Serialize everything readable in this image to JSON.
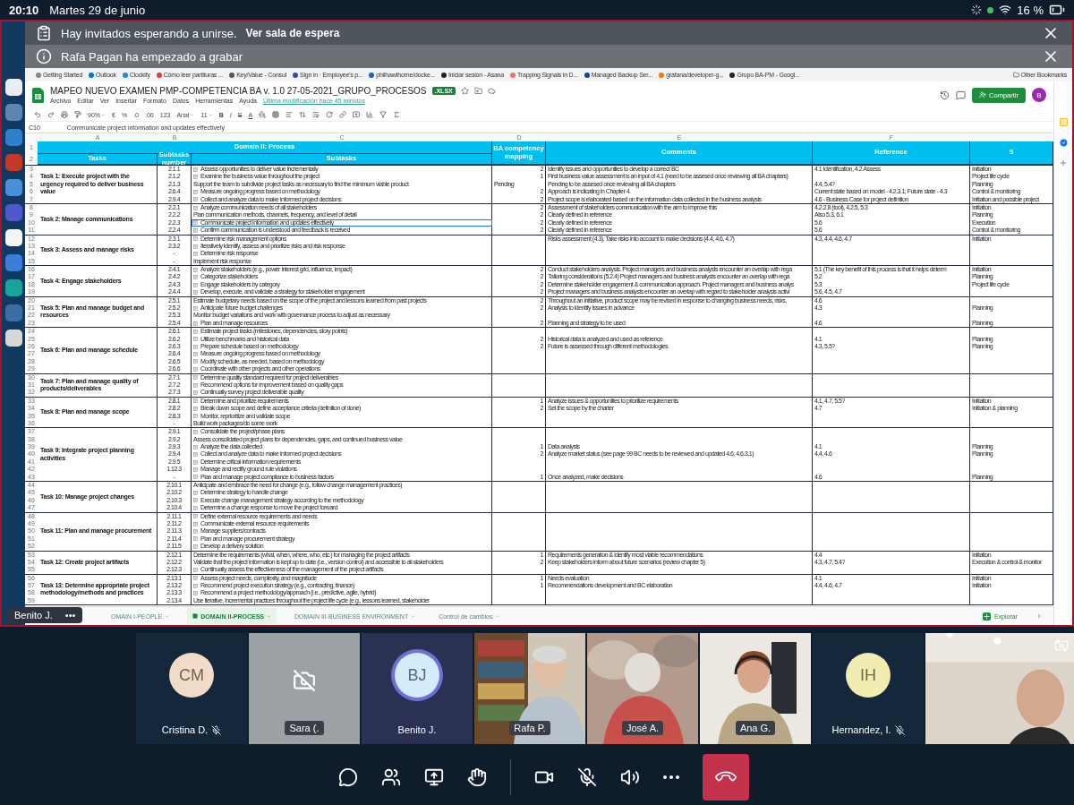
{
  "status_bar": {
    "time": "20:10",
    "date": "Martes 29 de junio",
    "battery": "16 %"
  },
  "banners": [
    {
      "kind": "lobby",
      "text": "Hay invitados esperando a unirse.",
      "link": "Ver sala de espera"
    },
    {
      "kind": "info",
      "text": "Rafa Pagan ha empezado a grabar"
    }
  ],
  "bookmarks": [
    "Getting Started",
    "Outlook",
    "Clockify",
    "Cómo leer partituras ...",
    "Key/Value - Consul",
    "Sign in · Employee's p...",
    "philhawthorne/docke...",
    "Iniciar sesión - Asana",
    "Trapping Signals in D...",
    "Managed Backup Ser...",
    "grafana/developer-g...",
    "Grupo BA-PM - Googl..."
  ],
  "other_bookmarks": "Other Bookmarks",
  "sheet": {
    "title": "MAPEO NUEVO EXAMEN PMP-COMPETENCIA BA v. 1.0 27-05-2021_GRUPO_PROCESOS",
    "badge": ".XLSX",
    "menus": [
      "Archivo",
      "Editar",
      "Ver",
      "Insertar",
      "Formato",
      "Datos",
      "Herramientas",
      "Ayuda"
    ],
    "last_edit": "Última modificación hace 45 minutos",
    "share": "Compartir",
    "avatar": "B",
    "toolbar": [
      {
        "kind": "zoom",
        "text": "90%"
      },
      {
        "kind": "format",
        "text": "€"
      },
      {
        "kind": "format",
        "text": "%"
      },
      {
        "kind": "format",
        "text": ".0"
      },
      {
        "kind": "format",
        "text": ".00"
      },
      {
        "kind": "format",
        "text": "123"
      },
      {
        "kind": "font",
        "text": "Arial"
      },
      {
        "kind": "size",
        "text": "11"
      },
      {
        "kind": "bold",
        "text": "B"
      },
      {
        "kind": "italic",
        "text": "I"
      },
      {
        "kind": "strike",
        "text": "S"
      },
      {
        "kind": "color",
        "text": "A"
      }
    ],
    "formula_bar": {
      "cell": "C10",
      "value": "Communicate project information and updates effectively"
    },
    "column_letters": [
      "A",
      "B",
      "C",
      "D",
      "E",
      "F"
    ],
    "header_rows": [
      "1",
      "2"
    ],
    "domain_title": "Domain II: Process",
    "columns": [
      "Tasks",
      "Subtasks number",
      "Subtasks",
      "BA competency mapping",
      "Comments",
      "Reference",
      "S"
    ],
    "tasks": [
      {
        "title": "Task 1: Execute project with the urgency required to deliver business value",
        "subtasks": [
          {
            "row": "3",
            "number": "2.1.1",
            "text": "Assess opportunities to deliver value incrementally",
            "icon": true,
            "selected": false,
            "score": "2",
            "comment": "Identify issues and opportunities to develop a correct BC",
            "reference": "4.1 Identification, 4.2 Assess",
            "stage": "Initiation"
          },
          {
            "row": "4",
            "number": "2.1.2",
            "text": "Examine the business value throughout the project",
            "icon": true,
            "selected": false,
            "score": "1",
            "comment": "First business value assessment is an input of 4.1 (need to be assesed once reviewing all BA chapters)",
            "stage": "Project life cycle"
          },
          {
            "row": "5",
            "number": "2.1.3",
            "text": "Support the team to subdivide project tasks as necessary to find the minimum viable product",
            "icon": false,
            "selected": false,
            "mapping": "Pending",
            "comment": "Pending to be assesed once reviewing all BA chapters",
            "reference": "4.4, 5.4?",
            "stage": "Planning"
          },
          {
            "row": "6",
            "number": "2.6.4",
            "text": "Measure ongoing progress based on methodology",
            "icon": true,
            "selected": false,
            "score": "2",
            "comment": "Approach is indicating in Chapter 4.",
            "reference": "Current state based on model - 4.2.3.1; Future state - 4.3",
            "stage": "Control & monitoring"
          },
          {
            "row": "7",
            "number": "2.9.4",
            "text": "Collect and analyze data to make informed project decisions",
            "icon": true,
            "selected": false,
            "score": "2",
            "comment": "Project scope is elaborated based on the information data collected  in the business analysis",
            "reference": "4.6 - Business Case for project definition",
            "stage": "Initiation and possible project"
          }
        ]
      },
      {
        "title": "Task 2: Manage communications",
        "subtasks": [
          {
            "row": "8",
            "number": "2.2.1",
            "text": "Analyze communication needs of all stakeholders",
            "icon": true,
            "selected": false,
            "score": "2",
            "comment": "Assessment of stakeholders communication with the aim to improve this",
            "reference": "4.2.2.8 (tool), 4.2.5, 5.3",
            "stage": "Initiation"
          },
          {
            "row": "9",
            "number": "2.2.2",
            "text": "Plan communication methods, channels, frequency, and level of detail",
            "icon": false,
            "selected": false,
            "score": "2",
            "comment": "Clearly defined in reference",
            "reference": "Also 5.3, 6.1",
            "stage": "Planning"
          },
          {
            "row": "10",
            "number": "2.2.3",
            "text": "Communicate project information and updates effectively",
            "icon": true,
            "selected": true,
            "score": "2",
            "comment": "Clearly defined in reference",
            "reference": "5.6",
            "stage": "Execution"
          },
          {
            "row": "11",
            "number": "2.2.4",
            "text": "Confirm communication is understood and feedback is received",
            "icon": true,
            "selected": false,
            "score": "2",
            "comment": "Clearly defined in reference",
            "reference": "5.6",
            "stage": "Control & monitoring"
          }
        ]
      },
      {
        "title": "Task 3: Assess and manage risks",
        "subtasks": [
          {
            "row": "12",
            "number": "2.3.1",
            "text": "Determine risk management options",
            "icon": true,
            "selected": false,
            "comment": "Risks assessment (4.3). Take risks into account to make decisions  (4.4, 4.6, 4.7)",
            "reference": "4.3, 4.4, 4.6, 4.7",
            "stage": "Initiation"
          },
          {
            "row": "13",
            "number": "2.3.2",
            "text": "Iteratively identify, assess and prioritize risks and risk response",
            "icon": true,
            "selected": false
          },
          {
            "row": "14",
            "number": "-",
            "text": "Determine risk response",
            "icon": true,
            "selected": false
          },
          {
            "row": "15",
            "number": "-",
            "text": "Implement risk response",
            "icon": false,
            "selected": false
          }
        ]
      },
      {
        "title": "Task 4: Engage stakeholders",
        "subtasks": [
          {
            "row": "16",
            "number": "2.4.1",
            "text": "Analyze stakeholders (e.g., power interest grid, influence, impact)",
            "icon": true,
            "selected": false,
            "score": "2",
            "comment": "Conduct stakeholders analysis. Project managers and business analysts encounter an overlap with rega",
            "reference": "5.1 (The key benefit of this process is that it helps determ",
            "stage": "Initiation"
          },
          {
            "row": "17",
            "number": "2.4.2",
            "text": "Categorize stakeholders",
            "icon": true,
            "selected": false,
            "score": "2",
            "comment": "Tailoring considerations (5.2.4) Project managers and business analysts encounter an overlap with rega",
            "reference": "5.2",
            "stage": "Planning"
          },
          {
            "row": "18",
            "number": "2.4.3",
            "text": "Engage stakeholders by category",
            "icon": true,
            "selected": false,
            "score": "2",
            "comment": "Determine stakeholder engagement & communication approach. Project managers and business analys",
            "reference": "5.3",
            "stage": "Project life cycle"
          },
          {
            "row": "19",
            "number": "2.4.4",
            "text": "Develop, execute, and validate a strategy for stakeholder engagement",
            "icon": true,
            "selected": false,
            "score": "2",
            "comment": "Project managers and business analysts encounter an overlap with regard to stakeholder analysis activi",
            "reference": "5.6, 4.5, 4.7"
          }
        ]
      },
      {
        "title": "Task 5: Plan and manage budget and resources",
        "subtasks": [
          {
            "row": "20",
            "number": "2.5.1",
            "text": "Estimate budgetary needs based on the scope of the project and lessons learned from past projects",
            "icon": false,
            "selected": false,
            "score": "2",
            "comment": "Throughout an initiative, product scope may be revised in response to changing business needs, risks,",
            "reference": "4.6"
          },
          {
            "row": "21",
            "number": "2.5.2",
            "text": "Anticipate future budget challenges",
            "icon": true,
            "selected": false,
            "score": "2",
            "comment": "Analysis to identify issues in advance",
            "reference": "4.3",
            "stage": "Planning"
          },
          {
            "row": "22",
            "number": "2.5.3",
            "text": "Monitor budget variations and work with governance process to adjust as necessary",
            "icon": false,
            "selected": false
          },
          {
            "row": "23",
            "number": "2.5.4",
            "text": "Plan and manage resources",
            "icon": true,
            "selected": false,
            "score": "2",
            "comment": "Planning and strategy to be used",
            "reference": "4.6",
            "stage": "Planning"
          }
        ]
      },
      {
        "title": "Task 6: Plan and manage schedule",
        "subtasks": [
          {
            "row": "24",
            "number": "2.6.1",
            "text": "Estimate project tasks (milestones, dependencies, story points)",
            "icon": true,
            "selected": false
          },
          {
            "row": "25",
            "number": "2.6.2",
            "text": "Utilize benchmarks and historical data",
            "icon": true,
            "selected": false,
            "score": "2",
            "comment": "Historical data is analyzed and used as reference",
            "reference": "4.1",
            "stage": "Planning"
          },
          {
            "row": "26",
            "number": "2.6.3",
            "text": "Prepare schedule based on methodology",
            "icon": true,
            "selected": false,
            "score": "2",
            "comment": "Future is assessed through different methodologies.",
            "reference": "4.3, 5.5?",
            "stage": "Planning"
          },
          {
            "row": "27",
            "number": "2.6.4",
            "text": "Measure ongoing progress based on methodology",
            "icon": true,
            "selected": false
          },
          {
            "row": "28",
            "number": "2.6.5",
            "text": "Modify schedule, as needed, based on methodology",
            "icon": true,
            "selected": false
          },
          {
            "row": "29",
            "number": "2.6.6",
            "text": "Coordinate with other projects and other operations",
            "icon": true,
            "selected": false
          }
        ]
      },
      {
        "title": "Task 7: Plan and manage quality of products/deliverables",
        "subtasks": [
          {
            "row": "30",
            "number": "2.7.1",
            "text": "Determine quality standard required for project deliverables",
            "icon": true,
            "selected": false
          },
          {
            "row": "31",
            "number": "2.7.2",
            "text": "Recommend options for improvement based on quality gaps",
            "icon": true,
            "selected": false
          },
          {
            "row": "32",
            "number": "2.7.3",
            "text": "Continually survey project deliverable quality",
            "icon": true,
            "selected": false
          }
        ]
      },
      {
        "title": "Task 8: Plan and manage scope",
        "subtasks": [
          {
            "row": "33",
            "number": "2.8.1",
            "text": "Determine and prioritize requirements",
            "icon": true,
            "selected": false,
            "score": "1",
            "comment": "Analyze issues & opportunities to prioritize requirements",
            "reference": "4.1, 4.7, 5.5?",
            "stage": "Initiation"
          },
          {
            "row": "34",
            "number": "2.8.2",
            "text": "Break down scope and define acceptance criteria (definition of done)",
            "icon": true,
            "selected": false,
            "score": "2",
            "comment": "Set the scope by the charter",
            "reference": "4.7",
            "stage": "Initiation & planning"
          },
          {
            "row": "35",
            "number": "2.8.3",
            "text": "Monitor, reprioritize and validate scope",
            "icon": true,
            "selected": false
          },
          {
            "row": "36",
            "number": "-",
            "text": "Build work packages/do some work",
            "icon": false,
            "selected": false
          }
        ]
      },
      {
        "title": "Task 9: Integrate project planning activities",
        "subtasks": [
          {
            "row": "37",
            "number": "2.9.1",
            "text": "Consolidate the project/phase plans",
            "icon": true,
            "selected": false
          },
          {
            "row": "38",
            "number": "2.9.2",
            "text": "Assess consolidated project plans for dependencies, gaps, and continued business value",
            "icon": false,
            "selected": false
          },
          {
            "row": "39",
            "number": "2.9.3",
            "text": "Analyze the data collected",
            "icon": true,
            "selected": false,
            "score": "1",
            "comment": "Data analysis",
            "reference": "4.1",
            "stage": "Planning"
          },
          {
            "row": "40",
            "number": "2.9.4",
            "text": "Collect and analyze data to make informed project decisions",
            "icon": true,
            "selected": false,
            "score": "2",
            "comment": "Analyze market status (see page 99 BC needs to be reviewed and updated 4.6, 4.6.3.1)",
            "reference": "4.4, 4.6",
            "stage": "Planning"
          },
          {
            "row": "41",
            "number": "2.9.5",
            "text": "Determine critical information requirements",
            "icon": true,
            "selected": false
          },
          {
            "row": "42",
            "number": "1.12.3",
            "text": "Manage and rectify ground rule violations",
            "icon": true,
            "selected": false
          },
          {
            "row": "43",
            "number": "-",
            "text": "Plan and manage project compliance to business factors",
            "icon": true,
            "selected": false,
            "score": "1",
            "comment": "Once analyzed, make decisions",
            "reference": "4.6",
            "stage": "Planning"
          }
        ]
      },
      {
        "title": "Task 10: Manage project changes",
        "subtasks": [
          {
            "row": "44",
            "number": "2.10.1",
            "text": "Anticipate and embrace the need for change (e.g., follow change management practices)",
            "icon": false,
            "selected": false
          },
          {
            "row": "45",
            "number": "2.10.2",
            "text": "Determine strategy to handle change",
            "icon": true,
            "selected": false
          },
          {
            "row": "46",
            "number": "2.10.3",
            "text": "Execute change management strategy according to the methodology",
            "icon": true,
            "selected": false
          },
          {
            "row": "47",
            "number": "2.10.4",
            "text": "Determine a change response to move the project forward",
            "icon": true,
            "selected": false
          }
        ]
      },
      {
        "title": "Task 11: Plan and manage procurement",
        "subtasks": [
          {
            "row": "48",
            "number": "2.11.1",
            "text": "Define external resource requirements and needs",
            "icon": true,
            "selected": false
          },
          {
            "row": "49",
            "number": "2.11.2",
            "text": "Communicate external resource requirements",
            "icon": true,
            "selected": false
          },
          {
            "row": "50",
            "number": "2.11.3",
            "text": "Manage suppliers/contracts",
            "icon": true,
            "selected": false
          },
          {
            "row": "51",
            "number": "2.11.4",
            "text": "Plan and manage procurement strategy",
            "icon": true,
            "selected": false
          },
          {
            "row": "52",
            "number": "2.11.5",
            "text": "Develop a delivery solution",
            "icon": true,
            "selected": false
          }
        ]
      },
      {
        "title": "Task 12: Create project artifacts",
        "subtasks": [
          {
            "row": "53",
            "number": "2.12.1",
            "text": "Determine the requirements (what, when, where, who, etc.) for managing the project artifacts",
            "icon": false,
            "selected": false,
            "score": "1",
            "comment": "Requirements generation & identify most viable recommendations",
            "reference": "4.4",
            "stage": "Initiation"
          },
          {
            "row": "54",
            "number": "2.12.2",
            "text": "Validate that the project information is kept up to date (i.e., version control) and accessible to all stakeholders",
            "icon": false,
            "selected": false,
            "score": "2",
            "comment": "Keep stakeholders inform about future scenarios (review chapter 5)",
            "reference": "4.3, 4.7, 5.4?",
            "stage": "Execution & control & monitor"
          },
          {
            "row": "55",
            "number": "2.12.3",
            "text": "Continually assess the effectiveness of the management of the project artifacts",
            "icon": true,
            "selected": false
          }
        ]
      },
      {
        "title": "Task 13: Determine appropriate project methodology/methods and practices",
        "subtasks": [
          {
            "row": "56",
            "number": "2.13.1",
            "text": "Assess project needs, complexity, and magnitude",
            "icon": true,
            "selected": false,
            "score": "1",
            "comment": "Needs evaluation",
            "reference": "4.1",
            "stage": "Initiation"
          },
          {
            "row": "57",
            "number": "2.13.2",
            "text": "Recommend project execution strategy (e.g., contracting, finance)",
            "icon": true,
            "selected": false,
            "score": "1",
            "comment": "Recommendations development and BC elaboration",
            "reference": "4.4, 4.6, 4.7",
            "stage": "Initiation"
          },
          {
            "row": "58",
            "number": "2.13.3",
            "text": "Recommend a project methodology/approach (i.e., predictive, agile, hybrid)",
            "icon": true,
            "selected": false
          },
          {
            "row": "59",
            "number": "2.13.4",
            "text": "Use iterative, incremental practices throughout the project life cycle (e.g., lessons learned, stakeholder",
            "icon": false,
            "selected": false
          }
        ]
      }
    ],
    "tabs": [
      {
        "label": "OMAIN I-PEOPLE",
        "selected": false
      },
      {
        "label": "DOMAIN II-PROCESS",
        "selected": true
      },
      {
        "label": "DOMAIN III-BUSINESS ENVIRONMENT",
        "selected": false
      },
      {
        "label": "Control de cambios",
        "selected": false
      }
    ],
    "explore": "Explorar"
  },
  "presenter": {
    "name": "Benito J.",
    "more": "•••"
  },
  "participants": [
    {
      "kind": "avatar",
      "name": "Cristina D.",
      "initials": "CM",
      "color": "#f2dcc8",
      "muted": true,
      "speaking": false
    },
    {
      "kind": "camera_off",
      "name": "Sara (.",
      "muted": false,
      "speaking": false
    },
    {
      "kind": "avatar",
      "name": "Benito J.",
      "initials": "BJ",
      "color": "#d4ecfb",
      "muted": false,
      "speaking": true
    },
    {
      "kind": "video",
      "name": "Rafa P.",
      "muted": false,
      "speaking": false
    },
    {
      "kind": "video",
      "name": "José A.",
      "muted": false,
      "speaking": false
    },
    {
      "kind": "video",
      "name": "Ana G.",
      "muted": false,
      "speaking": false
    },
    {
      "kind": "avatar",
      "name": "Hernandez, I.",
      "initials": "IH",
      "color": "#f1ecb0",
      "muted": true,
      "speaking": false
    },
    {
      "kind": "self_video",
      "muted": false,
      "speaking": false
    }
  ],
  "controls": [
    {
      "kind": "chat"
    },
    {
      "kind": "people"
    },
    {
      "kind": "share"
    },
    {
      "kind": "react"
    },
    {
      "kind": "divider"
    },
    {
      "kind": "camera"
    },
    {
      "kind": "mic",
      "muted": true
    },
    {
      "kind": "speaker"
    },
    {
      "kind": "more"
    },
    {
      "kind": "hangup"
    }
  ]
}
